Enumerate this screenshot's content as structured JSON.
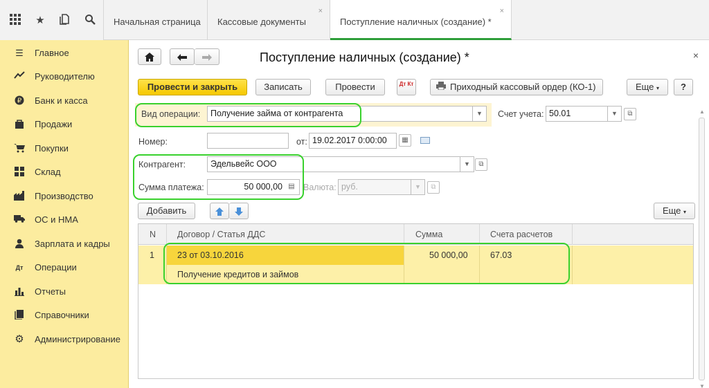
{
  "tabs": [
    {
      "label": "Начальная страница"
    },
    {
      "label": "Кассовые документы",
      "close": "×"
    },
    {
      "label": "Поступление наличных (создание) *",
      "close": "×"
    }
  ],
  "sidebar": {
    "items": [
      {
        "label": "Главное",
        "icon": "menu-icon"
      },
      {
        "label": "Руководителю",
        "icon": "chart-icon"
      },
      {
        "label": "Банк и касса",
        "icon": "bank-icon"
      },
      {
        "label": "Продажи",
        "icon": "bag-icon"
      },
      {
        "label": "Покупки",
        "icon": "cart-icon"
      },
      {
        "label": "Склад",
        "icon": "warehouse-icon"
      },
      {
        "label": "Производство",
        "icon": "factory-icon"
      },
      {
        "label": "ОС и НМА",
        "icon": "truck-icon"
      },
      {
        "label": "Зарплата и кадры",
        "icon": "person-icon"
      },
      {
        "label": "Операции",
        "icon": "operations-icon"
      },
      {
        "label": "Отчеты",
        "icon": "report-icon"
      },
      {
        "label": "Справочники",
        "icon": "book-icon"
      },
      {
        "label": "Администрирование",
        "icon": "gear-icon"
      }
    ]
  },
  "form": {
    "title": "Поступление наличных (создание) *",
    "close": "×",
    "toolbar": {
      "post_close": "Провести и закрыть",
      "save": "Записать",
      "post": "Провести",
      "dt_kt": "Дт Кт",
      "print_order": "Приходный кассовый ордер (КО-1)",
      "more": "Еще",
      "help": "?"
    },
    "operation_label": "Вид операции:",
    "operation_value": "Получение займа от контрагента",
    "account_label": "Счет учета:",
    "account_value": "50.01",
    "number_label": "Номер:",
    "number_value": "",
    "date_label": "от:",
    "date_value": "19.02.2017  0:00:00",
    "counterparty_label": "Контрагент:",
    "counterparty_value": "Эдельвейс ООО",
    "amount_label": "Сумма платежа:",
    "amount_value": "50 000,00",
    "currency_label": "Валюта:",
    "currency_value": "руб.",
    "add": "Добавить",
    "table_more": "Еще"
  },
  "table": {
    "columns": [
      "N",
      "Договор / Статья ДДС",
      "Сумма",
      "Счета расчетов"
    ],
    "rows": [
      {
        "n": "1",
        "contract": "23 от 03.10.2016",
        "article": "Получение кредитов и займов",
        "sum": "50 000,00",
        "account": "67.03"
      }
    ]
  },
  "colors": {
    "accent_green": "#39d12d",
    "sidebar_bg": "#fcec9f",
    "primary_button": "#f5c800"
  }
}
